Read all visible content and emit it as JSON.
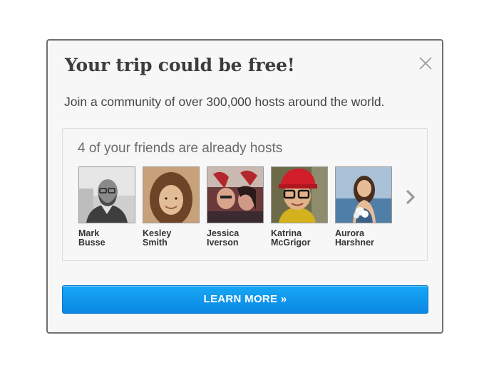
{
  "modal": {
    "title": "Your trip could be free!",
    "subtitle": "Join a community of over 300,000 hosts around the world.",
    "close_icon": "close-x-icon"
  },
  "friends": {
    "heading": "4 of your friends are already hosts",
    "next_icon": "chevron-right-icon",
    "items": [
      {
        "first": "Mark",
        "last": "Busse"
      },
      {
        "first": "Kesley",
        "last": "Smith"
      },
      {
        "first": "Jessica",
        "last": "Iverson"
      },
      {
        "first": "Katrina",
        "last": "McGrigor"
      },
      {
        "first": "Aurora",
        "last": "Harshner"
      }
    ]
  },
  "cta": {
    "label": "LEARN MORE »"
  },
  "colors": {
    "button": "#0b88e4",
    "modal_border": "#6f6f6f",
    "title": "#3c3c3c"
  }
}
